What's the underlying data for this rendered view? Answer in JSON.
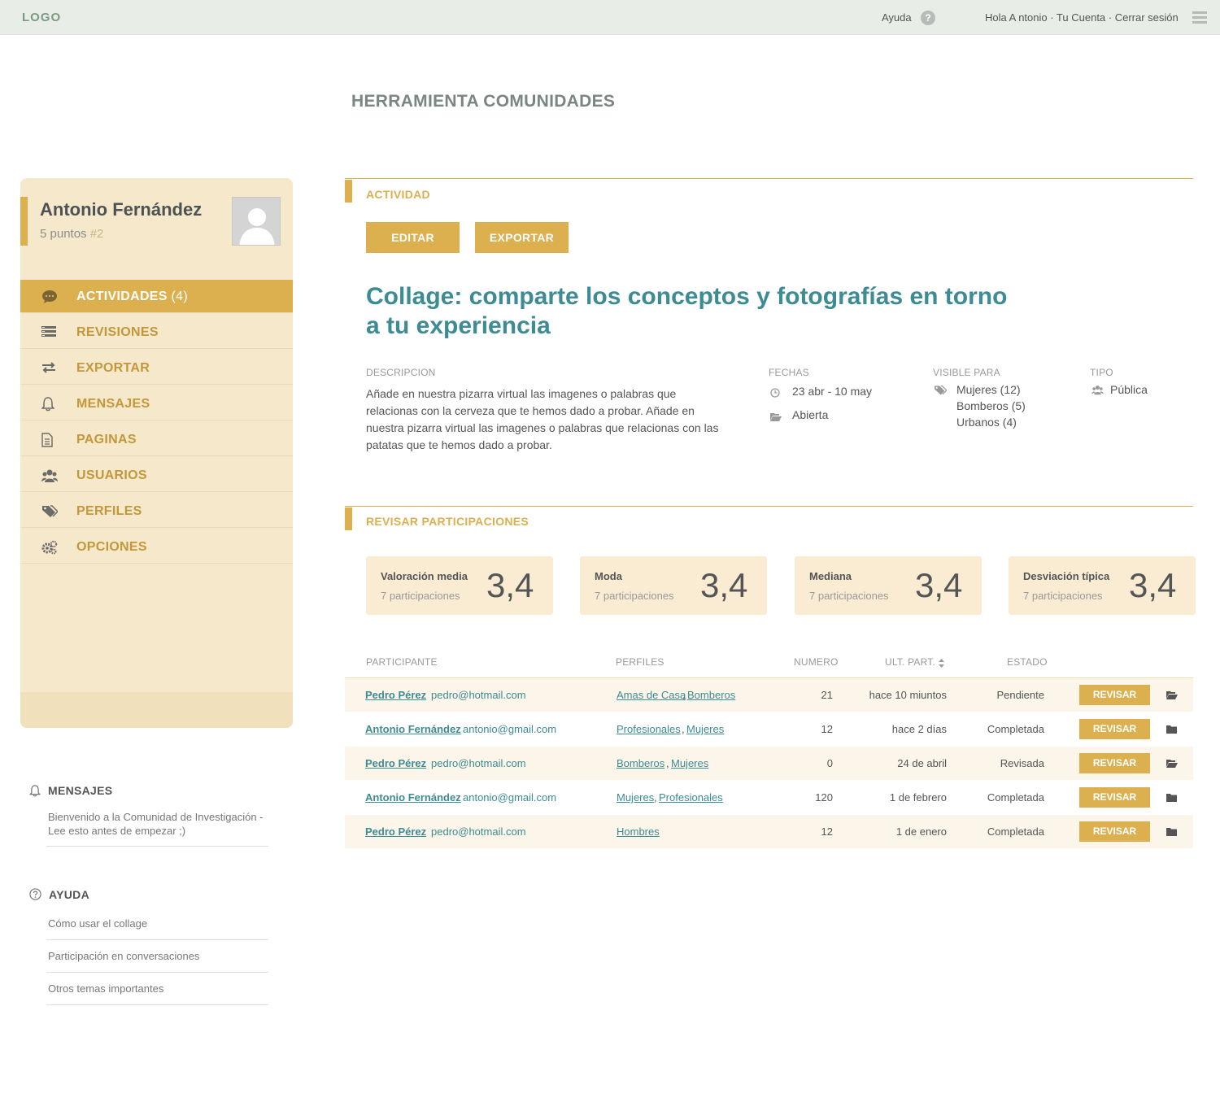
{
  "header": {
    "logo": "LOGO",
    "help_label": "Ayuda",
    "help_icon": "?",
    "user_links": "Hola A ntonio · Tu Cuenta · Cerrar sesión"
  },
  "page": {
    "title": "HERRAMIENTA COMUNIDADES"
  },
  "profile": {
    "name": "Antonio Fernández",
    "points": "5 puntos",
    "rank": "#2"
  },
  "nav": [
    {
      "label": "ACTIVIDADES",
      "count": "(4)",
      "icon": "chat-bubble-icon",
      "active": true
    },
    {
      "label": "REVISIONES",
      "icon": "list-icon"
    },
    {
      "label": "EXPORTAR",
      "icon": "arrows-exchange-icon"
    },
    {
      "label": "MENSAJES",
      "icon": "bell-icon"
    },
    {
      "label": "PAGINAS",
      "icon": "document-icon"
    },
    {
      "label": "USUARIOS",
      "icon": "users-icon"
    },
    {
      "label": "PERFILES",
      "icon": "tags-icon"
    },
    {
      "label": "OPCIONES",
      "icon": "gears-icon"
    }
  ],
  "side_messages": {
    "title": "MENSAJES",
    "text": "Bienvenido a la Comunidad de Investigación - Lee esto antes de empezar ;)"
  },
  "side_help": {
    "title": "AYUDA",
    "links": [
      "Cómo usar el collage",
      "Participación en conversaciones",
      "Otros temas importantes"
    ]
  },
  "activity": {
    "section_title": "ACTIVIDAD",
    "edit_label": "EDITAR",
    "export_label": "EXPORTAR",
    "title": "Collage: comparte los conceptos y fotografías en torno a tu experiencia",
    "desc_label": "DESCRIPCION",
    "desc_text": "Añade en nuestra pizarra virtual las imagenes o palabras que relacionas con la cerveza que te hemos dado a probar. Añade en nuestra pizarra virtual las imagenes o palabras que relacionas con las patatas que te hemos dado a probar.",
    "dates_label": "FECHAS",
    "dates": "23 abr - 10 may",
    "status": "Abierta",
    "visible_label": "VISIBLE PARA",
    "visible": [
      "Mujeres (12)",
      "Bomberos (5)",
      "Urbanos (4)"
    ],
    "type_label": "TIPO",
    "type": "Pública"
  },
  "review": {
    "section_title": "REVISAR PARTICIPACIONES",
    "stats": [
      {
        "label": "Valoración media",
        "sub": "7 participaciones",
        "value": "3,4"
      },
      {
        "label": "Moda",
        "sub": "7 participaciones",
        "value": "3,4"
      },
      {
        "label": "Mediana",
        "sub": "7 participaciones",
        "value": "3,4"
      },
      {
        "label": "Desviación típica",
        "sub": "7 participaciones",
        "value": "3,4"
      }
    ],
    "columns": [
      "PARTICIPANTE",
      "PERFILES",
      "NUMERO",
      "ULT. PART.",
      "ESTADO"
    ],
    "review_label": "REVISAR",
    "rows": [
      {
        "name": "Pedro Pérez ",
        "email": "pedro@hotmail.com",
        "profiles": [
          "Amas de Casa",
          "Bomberos"
        ],
        "number": "21",
        "last": "hace 10 miuntos",
        "status": "Pendiente",
        "folder": "folder-open-icon"
      },
      {
        "name": "Antonio Fernández",
        "email": "antonio@gmail.com",
        "profiles": [
          "Profesionales",
          "Mujeres"
        ],
        "number": "12",
        "last": "hace 2 días",
        "status": "Completada",
        "folder": "folder-icon"
      },
      {
        "name": "Pedro Pérez ",
        "email": "pedro@hotmail.com",
        "profiles": [
          "Bomberos",
          "Mujeres"
        ],
        "number": "0",
        "last": "24 de abril",
        "status": "Revisada",
        "folder": "folder-open-icon"
      },
      {
        "name": "Antonio Fernández",
        "email": "antonio@gmail.com",
        "profiles": [
          "Mujeres",
          "Profesionales"
        ],
        "number": "120",
        "last": "1 de febrero",
        "status": "Completada",
        "folder": "folder-icon"
      },
      {
        "name": "Pedro Pérez ",
        "email": "pedro@hotmail.com",
        "profiles": [
          "Hombres"
        ],
        "number": "12",
        "last": "1 de enero",
        "status": "Completada",
        "folder": "folder-icon"
      }
    ]
  },
  "colors": {
    "accent": "#dcaf4f",
    "teal": "#3d8b93",
    "sidebar_bg": "#f5e8cb"
  }
}
